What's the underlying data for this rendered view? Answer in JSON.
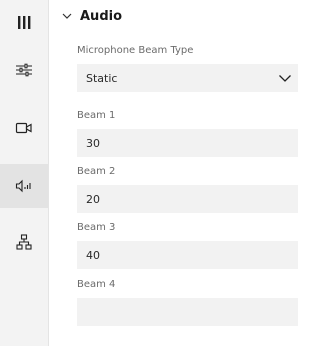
{
  "sidebar": {
    "items": [
      {
        "icon": "hamburger-menu-icon"
      },
      {
        "icon": "sliders-icon"
      },
      {
        "icon": "camera-icon"
      },
      {
        "icon": "speaker-audio-icon",
        "active": true
      },
      {
        "icon": "network-icon"
      }
    ]
  },
  "section": {
    "title": "Audio",
    "expanded": true
  },
  "fields": {
    "beam_type": {
      "label": "Microphone Beam Type",
      "value": "Static"
    },
    "beam1": {
      "label": "Beam 1",
      "value": "30"
    },
    "beam2": {
      "label": "Beam 2",
      "value": "20"
    },
    "beam3": {
      "label": "Beam 3",
      "value": "40"
    },
    "beam4": {
      "label": "Beam 4",
      "value": ""
    }
  },
  "colors": {
    "rail_bg": "#f3f3f3",
    "active_item_bg": "#e3e3e3",
    "field_bg": "#f2f2f2"
  }
}
